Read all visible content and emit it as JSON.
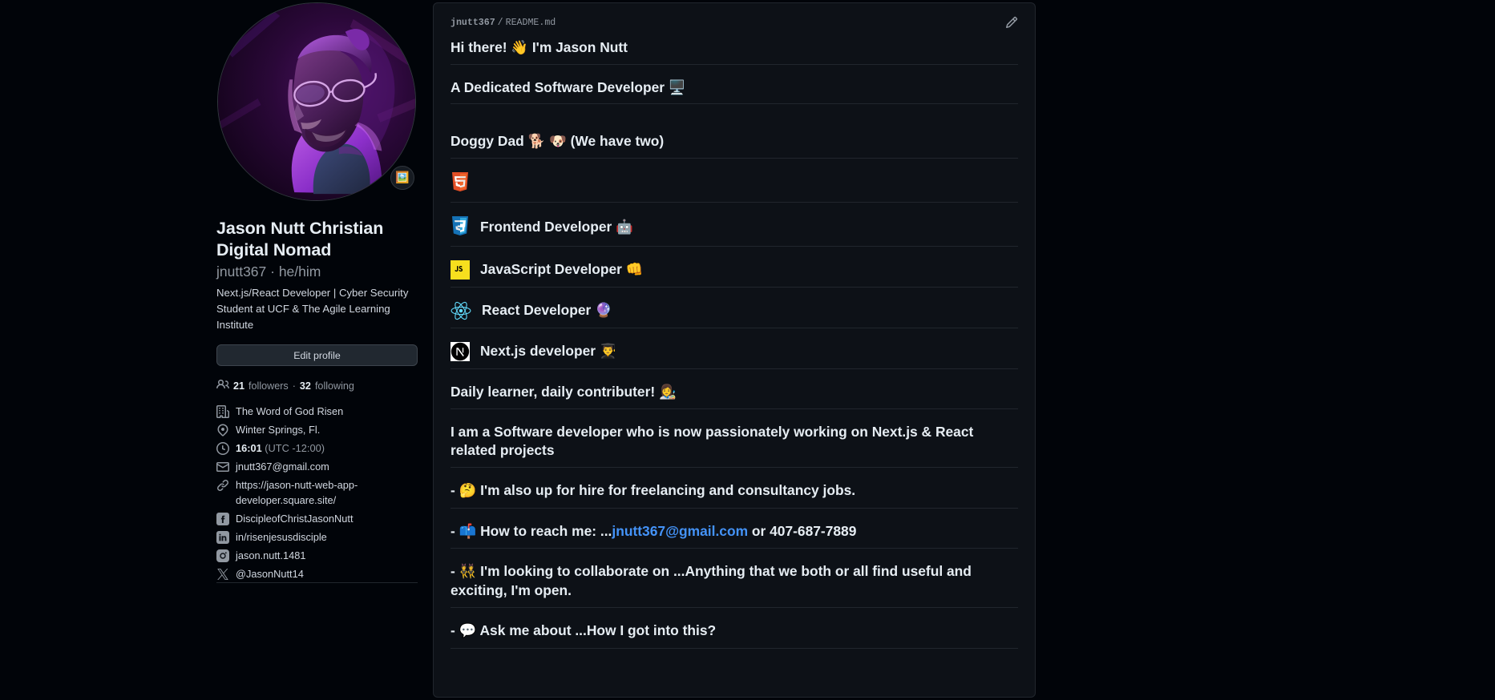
{
  "profile": {
    "avatar_alt": "neon purple portrait avatar",
    "status_emoji": "🖼️",
    "full_name": "Jason Nutt Christian Digital Nomad",
    "login": "jnutt367",
    "pronouns": "he/him",
    "login_line": "jnutt367 · he/him",
    "bio": "Next.js/React Developer | Cyber Security Student at UCF & The Agile Learning Institute",
    "edit_profile_label": "Edit profile",
    "followers_count": "21",
    "followers_label": "followers",
    "following_count": "32",
    "following_label": "following",
    "details": [
      {
        "icon": "organization-icon",
        "text": "The Word of God Risen",
        "muted": ""
      },
      {
        "icon": "location-icon",
        "text": "Winter Springs, Fl.",
        "muted": ""
      },
      {
        "icon": "clock-icon",
        "text": "16:01",
        "muted": "(UTC -12:00)"
      },
      {
        "icon": "mail-icon",
        "text": "jnutt367@gmail.com",
        "muted": ""
      },
      {
        "icon": "link-icon",
        "text": "https://jason-nutt-web-app-developer.square.site/",
        "muted": ""
      },
      {
        "icon": "facebook-icon",
        "text": "DiscipleofChristJasonNutt",
        "muted": ""
      },
      {
        "icon": "linkedin-icon",
        "text": "in/risenjesusdisciple",
        "muted": ""
      },
      {
        "icon": "instagram-icon",
        "text": "jason.nutt.1481",
        "muted": ""
      },
      {
        "icon": "x-twitter-icon",
        "text": "@JasonNutt14",
        "muted": ""
      }
    ]
  },
  "readme": {
    "breadcrumb_user": "jnutt367",
    "breadcrumb_slash": "/",
    "breadcrumb_file": "README.md",
    "edit_icon": "pencil-icon",
    "heading_1": "Hi there! 👋 I'm Jason Nutt",
    "heading_2": "A Dedicated Software Developer 🖥️",
    "heading_3": "Doggy Dad 🐕 🐶 (We have two)",
    "tech_rows": [
      {
        "logo": "html5-icon",
        "label": ""
      },
      {
        "logo": "css3-icon",
        "label": "Frontend Developer 🤖"
      },
      {
        "logo": "javascript-icon",
        "label": "JavaScript Developer 👊"
      },
      {
        "logo": "react-icon",
        "label": "React Developer 🔮"
      },
      {
        "logo": "nextjs-icon",
        "label": "Next.js developer 👨‍🎓"
      }
    ],
    "heading_4": "Daily learner, daily contributer! 👩‍🎨",
    "para_1": "I am a Software developer who is now passionately working on Next.js & React related projects",
    "bullet_1": "- 🤔 I'm also up for hire for freelancing and consultancy jobs.",
    "bullet_2_prefix": "- 📫 How to reach me: ...",
    "bullet_2_link": "jnutt367@gmail.com",
    "bullet_2_suffix": " or 407-687-7889",
    "bullet_3": "- 👯 I'm looking to collaborate on ...Anything that we both or all find useful and exciting, I'm open.",
    "bullet_4": "- 💬 Ask me about ...How I got into this?"
  },
  "colors": {
    "page_bg": "#010409",
    "panel_bg": "#0d1117",
    "border": "#21262d",
    "text": "#e6edf3",
    "muted": "#9198a1",
    "link": "#4493f8",
    "btn_bg": "#212830"
  }
}
